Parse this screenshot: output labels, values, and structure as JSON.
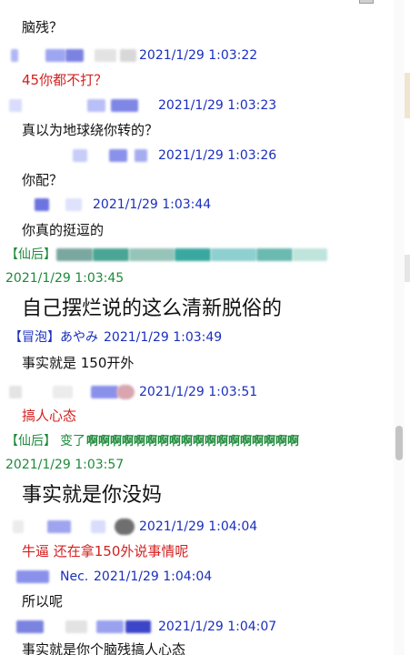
{
  "messages": [
    {
      "time": "",
      "text": "脑残？",
      "color": "normal"
    },
    {
      "time": "2021/1/29 1:03:22",
      "text": "45你都不打？",
      "color": "red"
    },
    {
      "time": "2021/1/29 1:03:23",
      "text": "真以为地球绕你转的？",
      "color": "normal"
    },
    {
      "time": "2021/1/29 1:03:26",
      "text": "你配？",
      "color": "normal"
    },
    {
      "time": "2021/1/29 1:03:44",
      "text": "你真的挺逗的",
      "color": "normal"
    },
    {
      "tag": "【仙后】",
      "time": "2021/1/29 1:03:45",
      "text": "自己摆烂说的这么清新脱俗的",
      "size": "big"
    },
    {
      "tag": "【冒泡】",
      "name": "あやみ",
      "time": "2021/1/29 1:03:49",
      "text": "事实就是 150开外"
    },
    {
      "time": "2021/1/29 1:03:51",
      "text": "搞人心态",
      "color": "red"
    },
    {
      "tag": "【仙后】",
      "name": "变了",
      "shout": "啊啊啊啊啊啊啊啊啊啊啊啊啊啊啊啊啊啊",
      "time": "2021/1/29 1:03:57",
      "text": "事实就是你没妈",
      "size": "big"
    },
    {
      "time": "2021/1/29 1:04:04",
      "text": "牛逼 还在拿150外说事情呢",
      "color": "red"
    },
    {
      "name": "Nec.",
      "time": "2021/1/29 1:04:04",
      "text": "所以呢"
    },
    {
      "time": "2021/1/29 1:04:07",
      "text": "事实就是你个脑残搞人心态"
    }
  ]
}
